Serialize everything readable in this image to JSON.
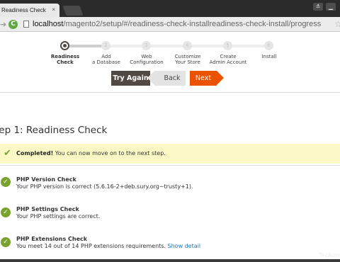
{
  "browser": {
    "tab_title": "Readiness Check",
    "tab_close": "×",
    "url_host": "localhost",
    "url_path": "/magento2/setup/#/readiness-check-installreadiness-check-install/progress",
    "icons": [
      "forward-arrow-icon",
      "reload-icon",
      "page-icon",
      "star-icon",
      "minimize-icon",
      "window-icon"
    ]
  },
  "steps": [
    {
      "label_line1": "Readiness",
      "label_line2": "Check",
      "number": "",
      "current": true
    },
    {
      "label_line1": "Add",
      "label_line2": "a Database",
      "number": "2",
      "current": false
    },
    {
      "label_line1": "Web",
      "label_line2": "Configuration",
      "number": "3",
      "current": false
    },
    {
      "label_line1": "Customize",
      "label_line2": "Your Store",
      "number": "4",
      "current": false
    },
    {
      "label_line1": "Create",
      "label_line2": "Admin Account",
      "number": "5",
      "current": false
    },
    {
      "label_line1": "Install",
      "label_line2": "",
      "number": "6",
      "current": false
    }
  ],
  "progress_fraction": 0.2,
  "buttons": {
    "try_again": "Try Again",
    "back": "Back",
    "next": "Next"
  },
  "page_title": "tep 1: Readiness Check",
  "message": {
    "bold": "Completed!",
    "text": " You can now move on to the next step."
  },
  "checks": [
    {
      "title": "PHP Version Check",
      "desc": "Your PHP version is correct (5.6.16-2+deb.sury.org~trusty+1).",
      "link": ""
    },
    {
      "title": "PHP Settings Check",
      "desc": "Your PHP settings are correct.",
      "link": ""
    },
    {
      "title": "PHP Extensions Check",
      "desc": "You meet 14 out of 14 PHP extensions requirements.",
      "link": "Show detail"
    }
  ],
  "watermark": "TecAdmin",
  "colors": {
    "accent": "#eb5202",
    "dark_button": "#514943",
    "success": "#79a22e",
    "message_bg": "#fbf8c5",
    "link": "#1979c3"
  }
}
